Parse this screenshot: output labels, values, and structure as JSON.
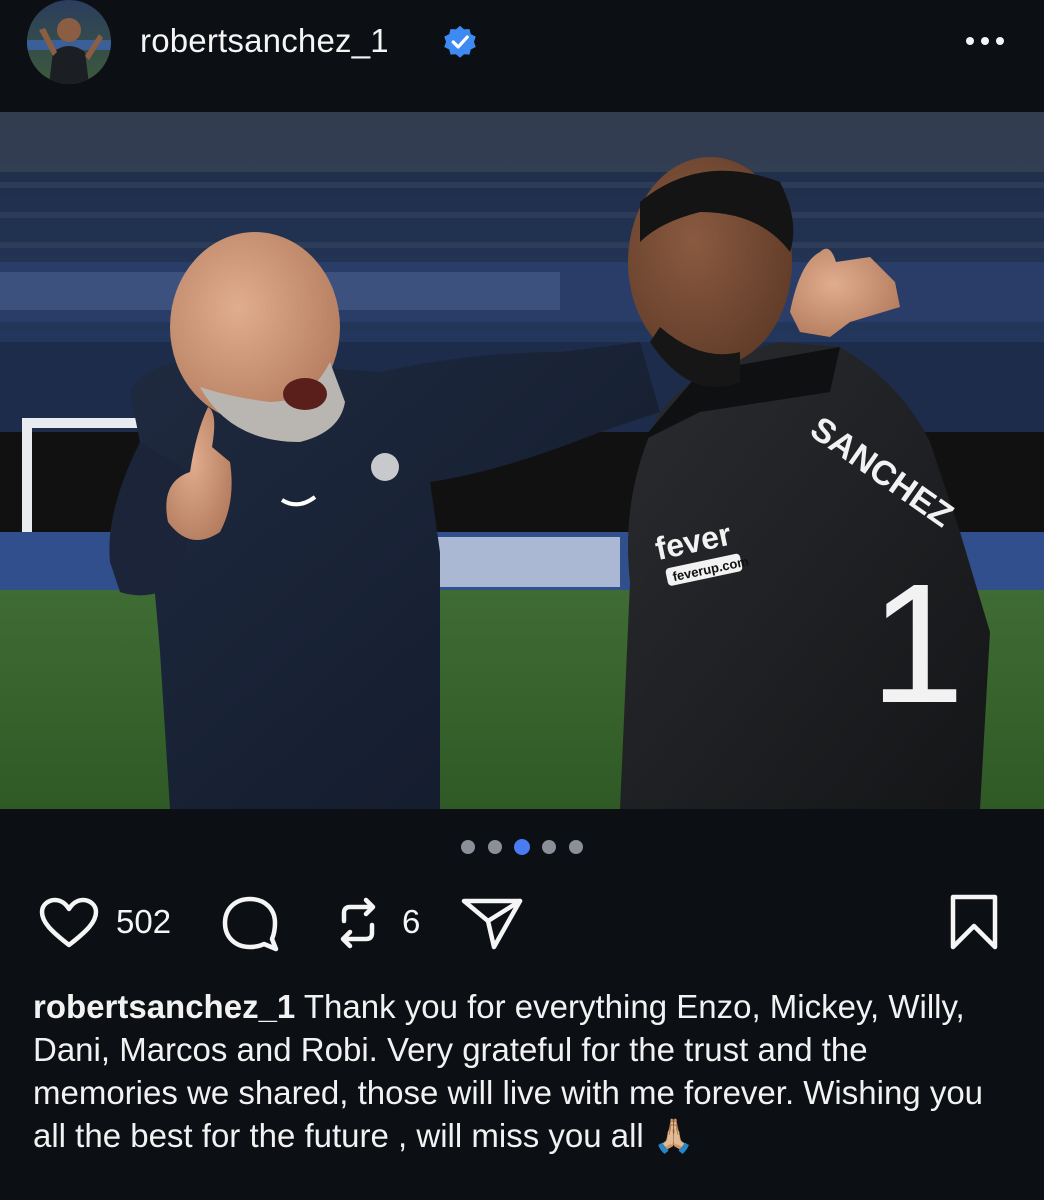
{
  "post": {
    "username": "robertsanchez_1",
    "verified": true,
    "media_count": 5,
    "active_media_index": 2
  },
  "actions": {
    "likes": "502",
    "reposts": "6"
  },
  "caption": {
    "username": "robertsanchez_1",
    "text": "Thank you for everything Enzo, Mickey, Willy, Dani, Marcos and Robi.  Very grateful for the trust and the memories we shared, those will live with me forever. Wishing you all the best for the future , will miss you all",
    "emoji": "🙏🏼"
  },
  "photo": {
    "shirt_name": "SANCHEZ",
    "shirt_number": "1",
    "sponsor": "fever",
    "sponsor_url": "feverup.com"
  },
  "colors": {
    "background": "#0c0f14",
    "verified_blue": "#3d8bf2",
    "active_dot": "#4a7bf2",
    "inactive_dot": "#8a8f98"
  },
  "icons": [
    "verified-badge-icon",
    "more-options-icon",
    "heart-icon",
    "comment-icon",
    "repost-icon",
    "share-icon",
    "bookmark-icon"
  ]
}
